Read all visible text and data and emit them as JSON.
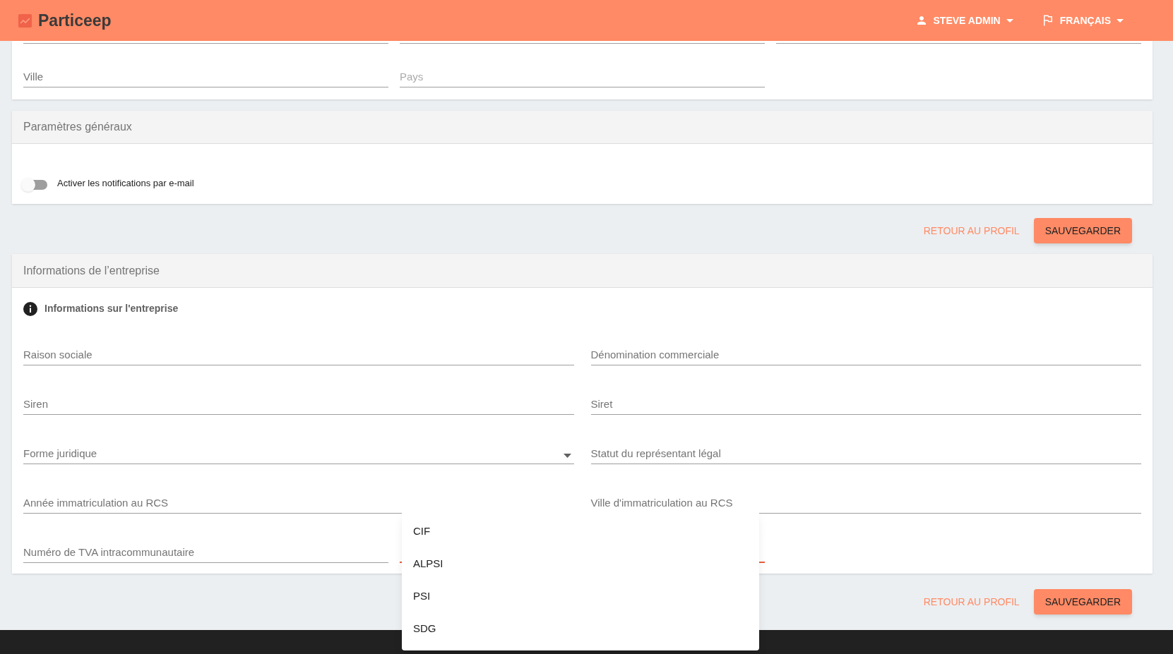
{
  "header": {
    "brand": "Particeep",
    "user_menu": "STEVE ADMIN",
    "language_menu": "FRANÇAIS"
  },
  "address_card": {
    "fields": [
      {
        "label": "Ville",
        "kind": "text"
      },
      {
        "label": "Pays",
        "kind": "placeholder"
      }
    ]
  },
  "general_settings": {
    "title": "Paramètres généraux",
    "toggle": {
      "label": "Activer les notifications par e-mail",
      "on": false
    }
  },
  "actions_1": {
    "back": "RETOUR AU PROFIL",
    "save": "SAUVEGARDER"
  },
  "company_card": {
    "title": "Informations de l’entreprise",
    "info": "Informations sur l'entreprise",
    "fields": [
      {
        "label": "Raison sociale",
        "kind": "text"
      },
      {
        "label": "Dénomination commerciale",
        "kind": "text"
      },
      {
        "label": "Siren",
        "kind": "text"
      },
      {
        "label": "Siret",
        "kind": "text"
      },
      {
        "label": "Forme juridique",
        "kind": "select"
      },
      {
        "label": "Statut du représentant légal",
        "kind": "text"
      },
      {
        "label": "Année immatriculation au RCS",
        "kind": "text"
      },
      {
        "label": "Ville d'immatriculation au RCS",
        "kind": "text"
      }
    ],
    "last_row": [
      {
        "label": "Numéro de TVA intracommunautaire",
        "kind": "text",
        "focused": false
      },
      {
        "kind": "select",
        "focused": true
      }
    ]
  },
  "actions_2": {
    "back": "RETOUR AU PROFIL",
    "save": "SAUVEGARDER"
  },
  "dropdown_menu": {
    "options": [
      "CIF",
      "ALPSI",
      "PSI",
      "SDG"
    ]
  }
}
